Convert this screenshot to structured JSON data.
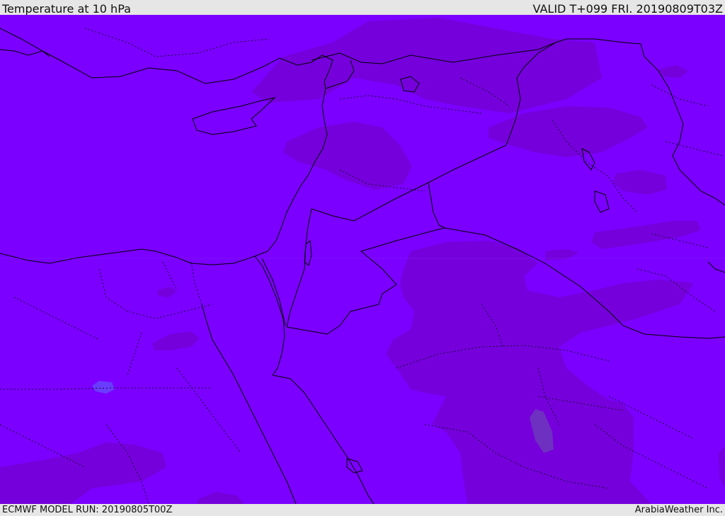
{
  "header": {
    "title": "Temperature at 10 hPa",
    "valid_time": "VALID T+099 FRI. 20190809T03Z"
  },
  "footer": {
    "model_run": "ECMWF MODEL RUN: 20190805T00Z",
    "credit": "ArabiaWeather Inc."
  },
  "colors": {
    "base_field": "#7b00ff",
    "warm_field": "#7700dd",
    "cool_patch": "#6a3cff",
    "border": "#000000",
    "chrome": "#e6e6e6"
  }
}
